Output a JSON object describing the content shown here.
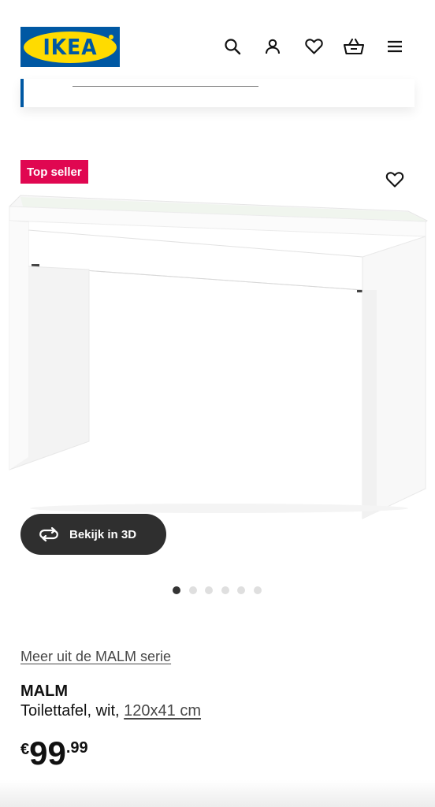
{
  "brand": {
    "logo_text": "IKEA"
  },
  "header": {
    "icons": [
      "search-icon",
      "user-icon",
      "heart-icon",
      "basket-icon",
      "menu-icon"
    ]
  },
  "product": {
    "badge": "Top seller",
    "view_3d_label": "Bekijk in 3D",
    "carousel": {
      "count": 6,
      "active_index": 0
    },
    "series_link": "Meer uit de MALM serie",
    "name": "MALM",
    "description": "Toilettafel, wit,",
    "dimensions": "120x41 cm",
    "price": {
      "currency": "€",
      "integer": "99",
      "decimal": ".99"
    }
  },
  "colors": {
    "brand_blue": "#0058a3",
    "brand_yellow": "#ffdb00",
    "badge_red": "#e00751",
    "button_dark": "#2f2f2f"
  }
}
